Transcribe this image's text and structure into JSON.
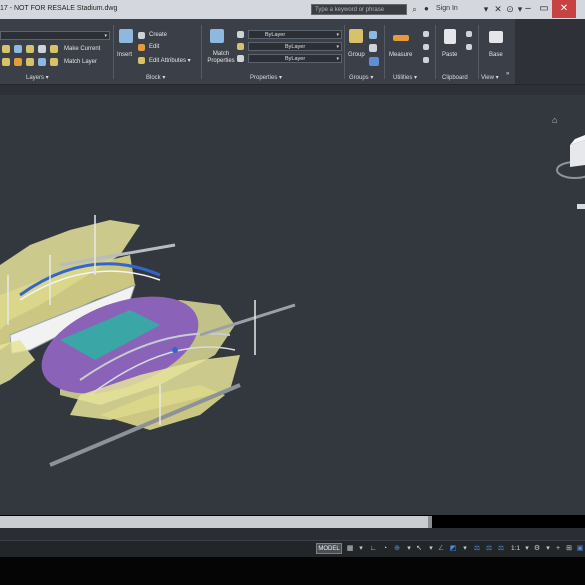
{
  "window": {
    "title": "17 - NOT FOR RESALE    Stadium.dwg",
    "search_placeholder": "Type a keyword or phrase",
    "sign_in": "Sign In",
    "minimize": "–",
    "restore": "▭",
    "close": "✕"
  },
  "ribbon": {
    "layers": {
      "make_current": "Make Current",
      "match_layer": "Match Layer",
      "label": "Layers ▾"
    },
    "block": {
      "insert": "Insert",
      "create": "Create",
      "edit": "Edit",
      "edit_attributes": "Edit Attributes ▾",
      "label": "Block ▾"
    },
    "properties": {
      "match_properties": "Match Properties",
      "color": "ByLayer",
      "linetype": "ByLayer",
      "lineweight": "ByLayer",
      "label": "Properties ▾"
    },
    "groups": {
      "group": "Group",
      "label": "Groups ▾"
    },
    "utilities": {
      "measure": "Measure",
      "label": "Utilities ▾"
    },
    "clipboard": {
      "paste": "Paste",
      "label": "Clipboard"
    },
    "view": {
      "base": "Base",
      "label": "View ▾"
    }
  },
  "status": {
    "model": "MODEL",
    "scale": "1:1"
  },
  "colors": {
    "viewport_bg": "#33383f",
    "ribbon_bg": "#3b4048",
    "stadium_yellow": "#e6e39a",
    "track_purple": "#8a63b8",
    "field_teal": "#3aa6a6"
  }
}
